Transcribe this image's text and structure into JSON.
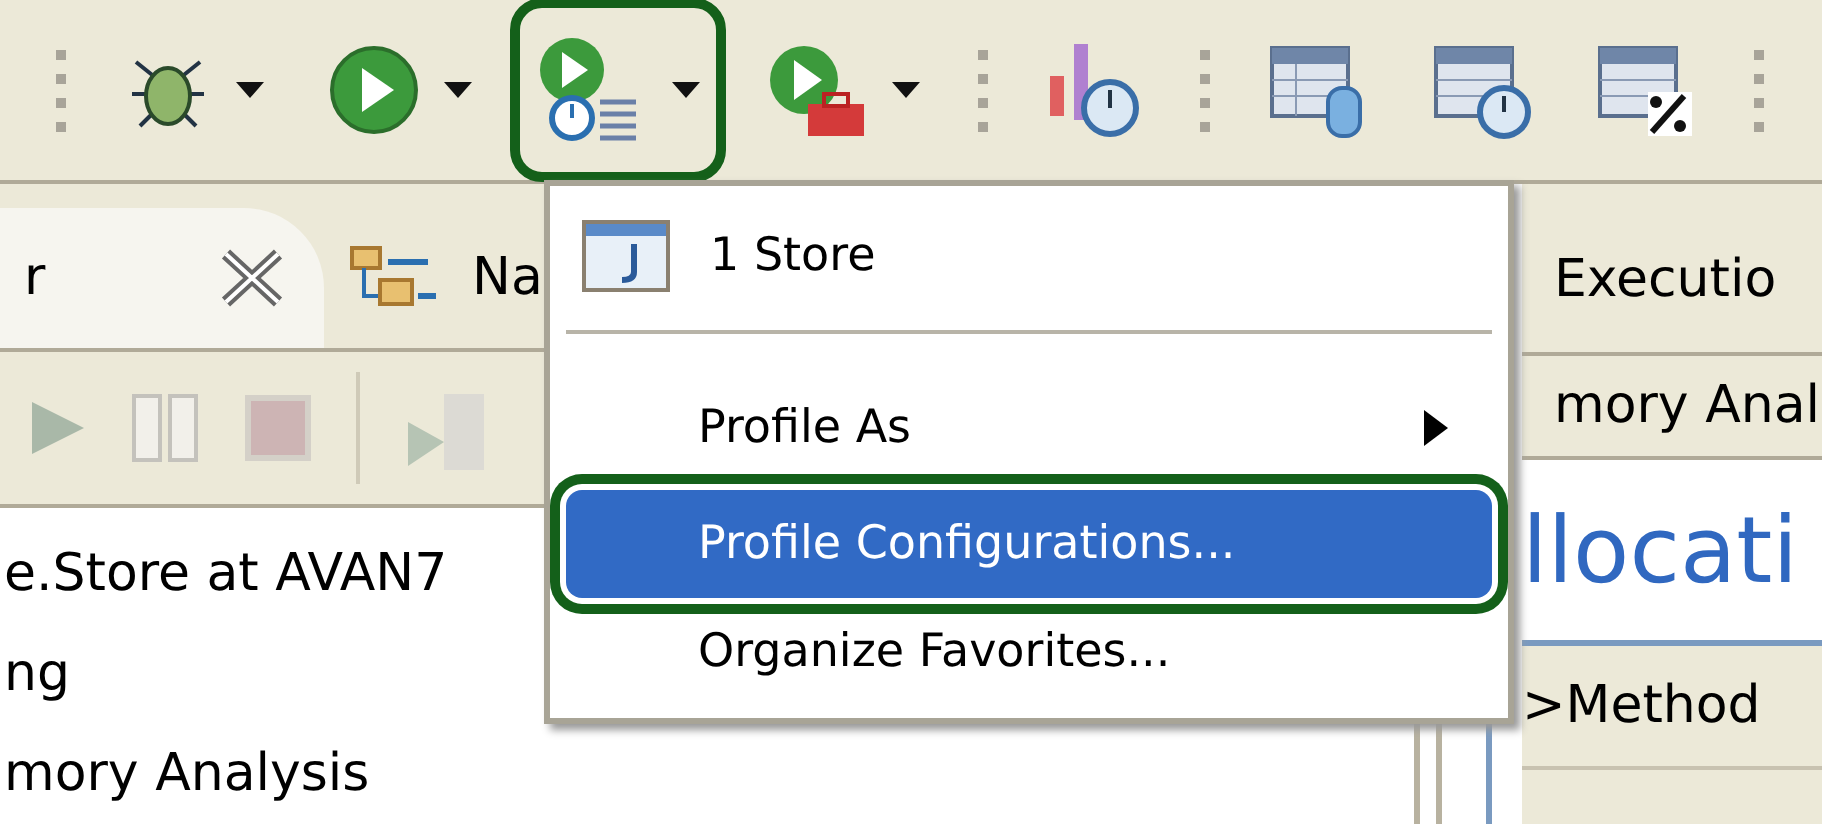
{
  "toolbar": {
    "items": [
      {
        "kind": "grip"
      },
      {
        "kind": "debug",
        "dropdown": true,
        "highlighted": false
      },
      {
        "kind": "run",
        "dropdown": true,
        "highlighted": false
      },
      {
        "kind": "profile",
        "dropdown": true,
        "highlighted": true
      },
      {
        "kind": "external-tools",
        "dropdown": true,
        "highlighted": false
      },
      {
        "kind": "grip"
      },
      {
        "kind": "timer-chart",
        "dropdown": false,
        "highlighted": false
      },
      {
        "kind": "grip"
      },
      {
        "kind": "table-database",
        "dropdown": false,
        "highlighted": false
      },
      {
        "kind": "table-timer",
        "dropdown": false,
        "highlighted": false
      },
      {
        "kind": "table-percent",
        "dropdown": false,
        "highlighted": false
      },
      {
        "kind": "grip"
      }
    ]
  },
  "left_view": {
    "tabs": [
      {
        "label": "r",
        "selected": true,
        "closable": true
      },
      {
        "label": "Na",
        "selected": false,
        "closable": false
      }
    ],
    "lines": [
      "e.Store at AVAN7",
      "ng",
      "mory Analysis"
    ]
  },
  "right_view": {
    "tabs": [
      "Executio",
      "mory Anal"
    ],
    "heading": "llocati",
    "column": ">Method"
  },
  "menu": {
    "items": [
      {
        "kind": "recent",
        "label": "1 Store"
      },
      {
        "kind": "separator"
      },
      {
        "kind": "submenu",
        "label": "Profile As",
        "selected": false,
        "highlighted": false
      },
      {
        "kind": "item",
        "label": "Profile Configurations...",
        "selected": true,
        "highlighted": true
      },
      {
        "kind": "item",
        "label": "Organize Favorites...",
        "selected": false,
        "highlighted": false
      }
    ]
  }
}
